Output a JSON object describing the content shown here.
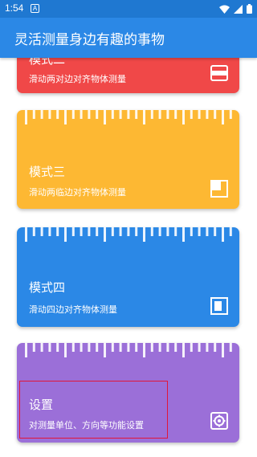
{
  "status_bar": {
    "time": "1:54",
    "notif_badge": "A"
  },
  "app_bar": {
    "title": "灵活测量身边有趣的事物"
  },
  "cards": [
    {
      "title": "模式二",
      "desc": "滑动两对边对齐物体测量",
      "color": "#f04848",
      "icon": "two-edge-icon"
    },
    {
      "title": "模式三",
      "desc": "滑动两临边对齐物体测量",
      "color": "#fdb833",
      "icon": "corner-icon"
    },
    {
      "title": "模式四",
      "desc": "滑动四边对齐物体测量",
      "color": "#2b88e6",
      "icon": "four-edge-icon"
    },
    {
      "title": "设置",
      "desc": "对测量单位、方向等功能设置",
      "color": "#9b6fd8",
      "icon": "settings-icon"
    }
  ]
}
